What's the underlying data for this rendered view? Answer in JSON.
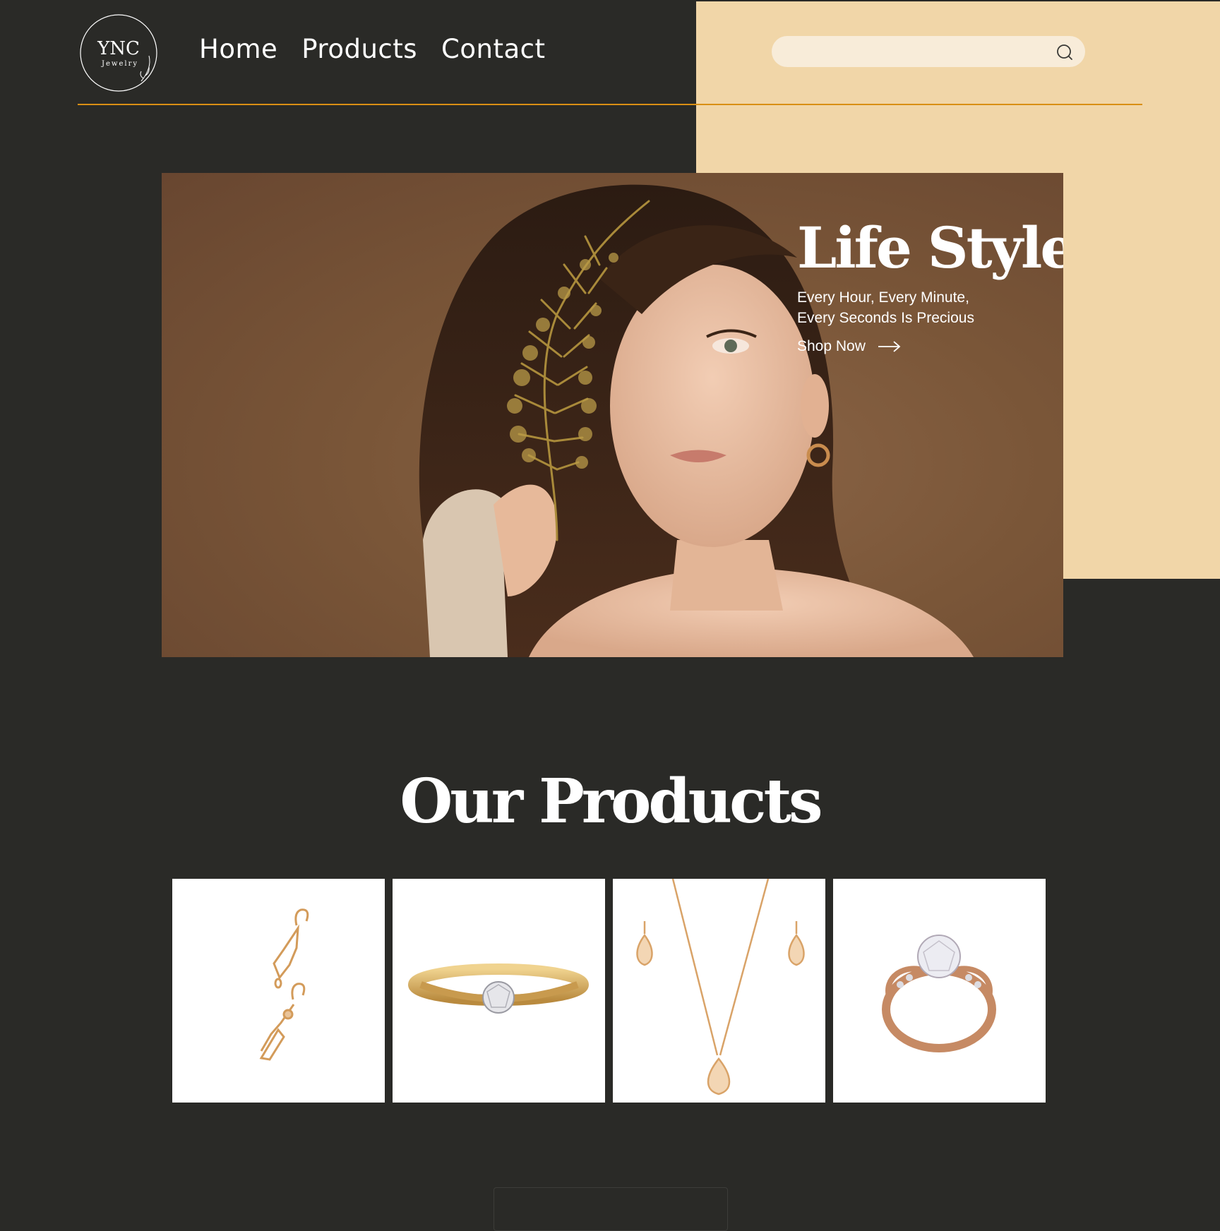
{
  "brand": {
    "logo_text": "YNC",
    "logo_sub": "Jewelry"
  },
  "nav": {
    "items": [
      {
        "label": "Home"
      },
      {
        "label": "Products"
      },
      {
        "label": "Contact"
      }
    ]
  },
  "search": {
    "value": "",
    "placeholder": "",
    "icon": "search-icon"
  },
  "hero": {
    "title": "Life Style",
    "subtitle": "Every Hour, Every Minute, Every Seconds Is Precious",
    "cta_label": "Shop Now",
    "cta_icon": "arrow-right-icon"
  },
  "products_section": {
    "title": "Our Products",
    "items": [
      {
        "image": "gold-link-earrings"
      },
      {
        "image": "gold-solitaire-ring"
      },
      {
        "image": "gold-teardrop-necklace-earrings-set"
      },
      {
        "image": "rose-gold-crystal-ring"
      }
    ]
  },
  "colors": {
    "background": "#2a2a27",
    "accent_beige": "#f1d6a8",
    "divider": "#d98f14",
    "search_bg": "#f8ecd9"
  }
}
